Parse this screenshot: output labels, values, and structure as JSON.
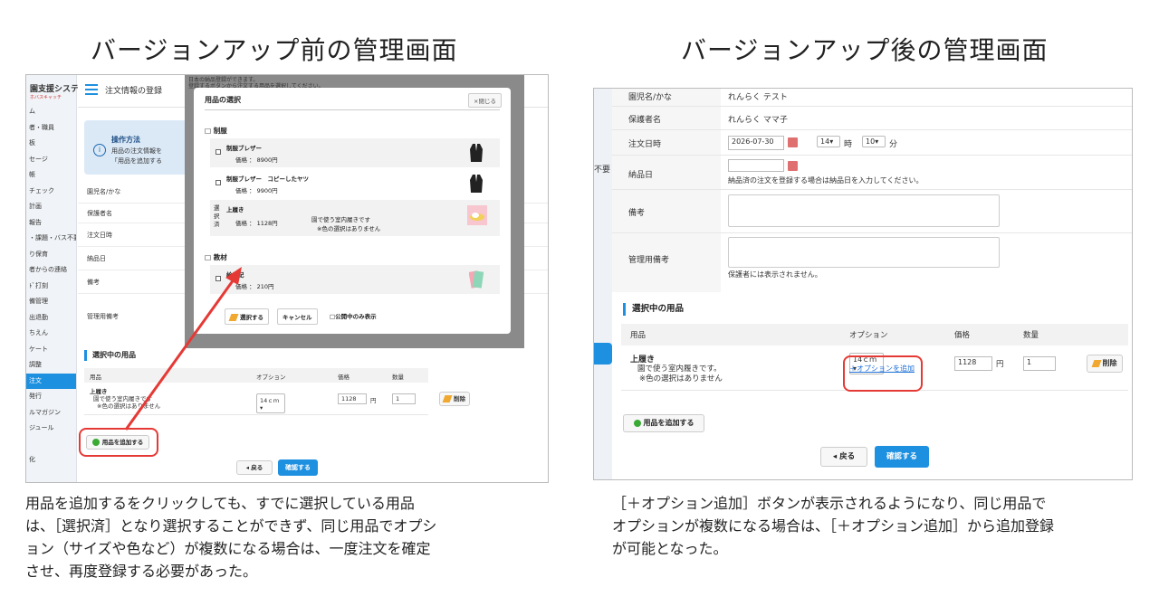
{
  "left": {
    "heading": "バージョンアップ前の管理画面",
    "caption": [
      "用品を追加するをクリックしても、すでに選択している用品",
      "は、［選択済］となり選択することができず、同じ用品でオプシ",
      "ョン（サイズや色など）が複数になる場合は、一度注文を確定",
      "させ、再度登録する必要があった。"
    ],
    "app": {
      "system_title": "園支援システム",
      "system_sub": "ホバスキャッチ",
      "sidebar": [
        "ム",
        "者・職員",
        "板",
        "セージ",
        "帳",
        "チェック",
        "計画",
        "報告",
        "・課題・バス不要",
        "り保育",
        "者からの連絡",
        "ﾄﾞ打刻",
        "備管理",
        "出退勤",
        "ちえん",
        "ケート",
        "調整",
        "注文",
        "発行",
        "ルマガジン",
        "ジュール",
        "",
        "化"
      ],
      "active_sidebar": 17,
      "header_title": "注文情報の登録",
      "help_title": "操作方法",
      "help_lines": [
        "用品の注文情報を",
        "「用品を追加する"
      ],
      "form_rows": [
        "園児名/かな",
        "保護者名",
        "注文日時",
        "納品日",
        "備考",
        "管理用備考"
      ],
      "section_title": "選択中の用品",
      "table_headers": [
        "用品",
        "オプション",
        "価格",
        "数量"
      ],
      "item_name": "上履き",
      "item_desc1": "園で使う室内履きです",
      "item_desc2": "※色の選択はありません",
      "option_value": "14ｃｍ",
      "price": "1128",
      "yen": "円",
      "qty": "1",
      "delete_label": "削除",
      "add_item_label": "用品を追加する",
      "back_label": "戻る",
      "confirm_label": "確認する"
    },
    "modal": {
      "title": "用品の選択",
      "close_label": "×閉じる",
      "categories": [
        {
          "name": "制服",
          "items": [
            {
              "name": "制服ブレザー",
              "price": "価格 ： 8900円"
            },
            {
              "name": "制服ブレザー　コピーしたヤツ",
              "price": "価格 ： 9900円"
            },
            {
              "name": "上履き",
              "price": "価格 ： 1128円",
              "status": "選択済",
              "desc1": "園で使う室内履きです",
              "desc2": "※色の選択はありません"
            }
          ]
        },
        {
          "name": "教材",
          "items": [
            {
              "name": "絵日記",
              "price": "価格 ： 210円"
            }
          ]
        }
      ],
      "select_label": "選択する",
      "cancel_label": "キャンセル",
      "public_only_label": "公開中のみ表示",
      "bg_text1": "日本の納品登録ができます。",
      "bg_text2": "登録するボタンから注文する用品を選択してください。"
    }
  },
  "right": {
    "heading": "バージョンアップ後の管理画面",
    "caption": [
      "［＋オプション追加］ボタンが表示されるようになり、同じ用品で",
      "オプションが複数になる場合は、［＋オプション追加］から追加登録",
      "が可能となった。"
    ],
    "app": {
      "sidebar_label": "不要",
      "rows": [
        {
          "label": "園児名/かな",
          "value": "れんらく テスト"
        },
        {
          "label": "保護者名",
          "value": "れんらく ママ子"
        }
      ],
      "order_label": "注文日時",
      "order_date": "2026-07-30",
      "order_hour": "14",
      "hour_unit": "時",
      "order_min": "10",
      "min_unit": "分",
      "delivery_label": "納品日",
      "delivery_hint": "納品済の注文を登録する場合は納品日を入力してください。",
      "remarks_label": "備考",
      "admin_remarks_label": "管理用備考",
      "admin_hint": "保護者には表示されません。",
      "section_title": "選択中の用品",
      "table_headers": [
        "用品",
        "オプション",
        "価格",
        "数量"
      ],
      "item_name": "上履き",
      "item_desc1": "園で使う室内履きです。",
      "item_desc2": "※色の選択はありません",
      "option_value": "14ｃｍ",
      "add_option_label": "＋オプションを追加",
      "price": "1128",
      "yen": "円",
      "qty": "1",
      "delete_label": "削除",
      "add_item_label": "用品を追加する",
      "back_label": "戻る",
      "confirm_label": "確認する"
    }
  },
  "colors": {
    "accent": "#1e90e0",
    "highlight": "#e53935",
    "arrow": "#e53935"
  }
}
